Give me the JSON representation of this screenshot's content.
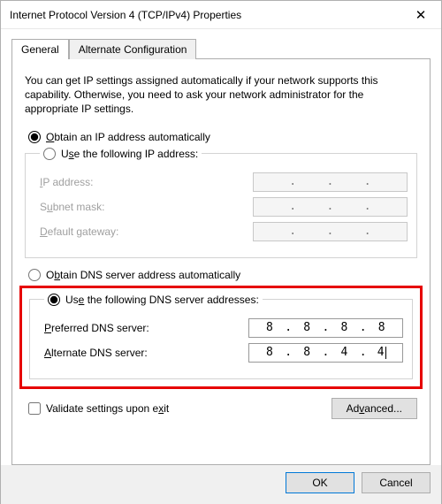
{
  "window": {
    "title": "Internet Protocol Version 4 (TCP/IPv4) Properties",
    "close_label": "✕"
  },
  "tabs": {
    "general": "General",
    "alternate": "Alternate Configuration"
  },
  "intro_text": "You can get IP settings assigned automatically if your network supports this capability. Otherwise, you need to ask your network administrator for the appropriate IP settings.",
  "ip_group": {
    "option_auto": "Obtain an IP address automatically",
    "option_manual": "Use the following IP address:",
    "selected": "auto",
    "fields": {
      "ip_label": "IP address:",
      "subnet_label": "Subnet mask:",
      "gateway_label": "Default gateway:",
      "ip_value": "",
      "subnet_value": "",
      "gateway_value": ""
    }
  },
  "dns_group": {
    "option_auto": "Obtain DNS server address automatically",
    "option_manual": "Use the following DNS server addresses:",
    "selected": "manual",
    "fields": {
      "preferred_label": "Preferred DNS server:",
      "alternate_label": "Alternate DNS server:",
      "preferred_value": [
        "8",
        "8",
        "8",
        "8"
      ],
      "alternate_value": [
        "8",
        "8",
        "4",
        "4"
      ]
    }
  },
  "validate": {
    "label": "Validate settings upon exit",
    "checked": false
  },
  "buttons": {
    "advanced": "Advanced...",
    "ok": "OK",
    "cancel": "Cancel"
  }
}
